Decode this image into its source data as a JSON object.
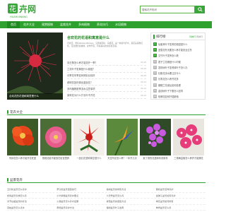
{
  "header": {
    "logo_text": "花卉网",
    "logo_sub": "HUAHUIWANG",
    "search_placeholder": "搜索花卉知识"
  },
  "colors": {
    "brand": "#2fa12f",
    "nav_active": "#1f8a1f"
  },
  "nav": {
    "items": [
      {
        "label": "首页"
      },
      {
        "label": "花卉大全"
      },
      {
        "label": "观赏植物"
      },
      {
        "label": "盆栽花卉"
      },
      {
        "label": "多肉植物"
      },
      {
        "label": "养花技巧"
      },
      {
        "label": "水培植物"
      }
    ]
  },
  "feature": {
    "caption": "合欢花的花语和寓意是什么",
    "title": "合欢花的花语和寓意是什么",
    "desc": "合欢花，学名Albizia julibrissin，又称绒花树、马缨花，是一种落叶乔木，其花朵呈粉红色，花丝细长如绒球，夏季开花，有着美好的寓意和花语。",
    "articles": [
      {
        "title": "向日葵怎么养才能花开一季？",
        "date": "06-15"
      },
      {
        "title": "兰花叶子发黄是什么原因？",
        "date": "06-15"
      },
      {
        "title": "月季花冬季如何修剪比较好",
        "date": "06-15"
      },
      {
        "title": "绣球花如何调出蓝色花？",
        "date": "06-14"
      },
      {
        "title": "多肉植物夏季浇水注意事项",
        "date": "06-14"
      },
      {
        "title": "茉莉花为什么只长叶不开花",
        "date": "06-14"
      },
      {
        "title": "栀子花掉叶子怎么办？",
        "date": "06-13"
      }
    ]
  },
  "ranking": {
    "title": "排行榜",
    "tab1": "月排行",
    "tab2": "周排行",
    "items": [
      {
        "n": "1",
        "t": "仙客来叶子发黄的原因是什么"
      },
      {
        "n": "2",
        "t": "蓝雪花冬天要怎么养才能安全过冬"
      },
      {
        "n": "3",
        "t": "文竹叶子发黄怎么救"
      },
      {
        "n": "4",
        "t": "君子兰花期是什么时候"
      },
      {
        "n": "5",
        "t": "发财树叶子发黄掉叶子怎么办"
      },
      {
        "n": "6",
        "t": "杜鹃花浇水要注意什么"
      },
      {
        "n": "7",
        "t": "长寿花怎么养开花多"
      },
      {
        "n": "8",
        "t": "蝴蝶兰花谢后如何处理"
      },
      {
        "n": "9",
        "t": "金钱树叶子下垂怎么回事"
      },
      {
        "n": "10",
        "t": "玫瑰花如何扦插繁殖"
      }
    ]
  },
  "section1": {
    "title": "花卉大全"
  },
  "flowers": [
    {
      "caption": "吊钟花怎么养才能开花旺盛"
    },
    {
      "caption": "蔷薇花能不能放在卧室里养"
    },
    {
      "caption": "一品红花语和寓意是什么"
    },
    {
      "caption": "天堂鸟花怎么养？一年开几次"
    },
    {
      "caption": "紫丁香的花语和传说故事"
    },
    {
      "caption": "三角梅盆栽怎么养护才能爆花"
    }
  ],
  "section2": {
    "title": "盆景花卉"
  },
  "grid": [
    [
      "五针松盆景怎么养护",
      "罗汉松盆景造型技巧",
      "榆树盆景的修剪方法",
      "黑松盆景怎样养护"
    ],
    [
      "雀梅盆景冬季怎么养",
      "小叶紫檀盆景养护要点",
      "六月雪盆景怎么养",
      "金弹子盆景如何养护"
    ],
    [
      "对节白蜡盆景的养法",
      "火棘盆景怎么养才结果",
      "紫薇盆景的造型方法",
      "梅花盆景如何修剪"
    ],
    [
      "真柏盆景怎么浇水",
      "黄杨盆景养护方法",
      "榕树盆景叶子发黄",
      "枸骨盆景怎么养"
    ]
  ]
}
